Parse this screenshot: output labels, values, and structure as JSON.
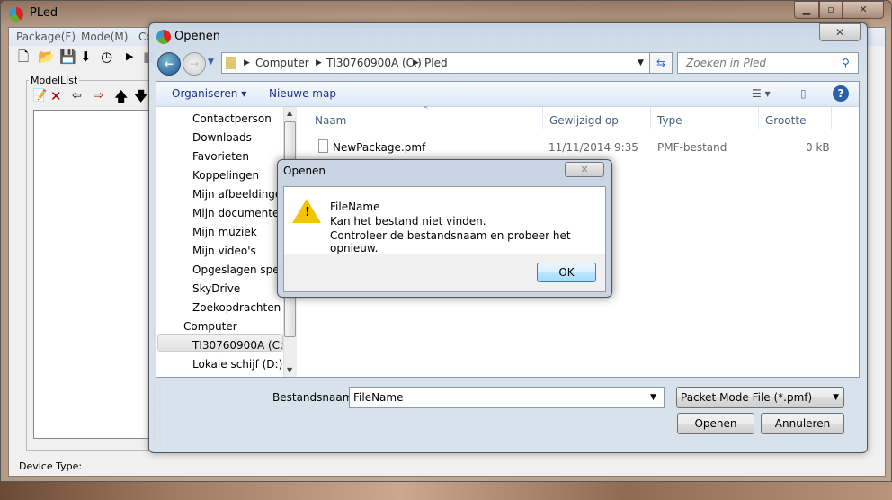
{
  "main_window": {
    "title": "PLed",
    "menu": [
      "Package(F)",
      "Mode(M)",
      "Co"
    ],
    "group_label": "ModelList",
    "status_label": "Device Type:"
  },
  "open_dialog": {
    "title": "Openen",
    "address": [
      "Computer",
      "TI30760900A (C:)",
      "Pled"
    ],
    "search_placeholder": "Zoeken in Pled",
    "toolbar": {
      "organize": "Organiseren",
      "new_folder": "Nieuwe map"
    },
    "nav_items": [
      "Contactperson",
      "Downloads",
      "Favorieten",
      "Koppelingen",
      "Mijn afbeeldingen",
      "Mijn documenten",
      "Mijn muziek",
      "Mijn video's",
      "Opgeslagen spellen",
      "SkyDrive",
      "Zoekopdrachten",
      "Computer",
      "TI30760900A (C:)",
      "Lokale schijf (D:)"
    ],
    "columns": [
      "Naam",
      "Gewijzigd op",
      "Type",
      "Grootte"
    ],
    "files": [
      {
        "name": "NewPackage.pmf",
        "modified": "11/11/2014 9:35",
        "type": "PMF-bestand",
        "size": "0 kB"
      }
    ],
    "filename_label": "Bestandsnaam:",
    "filename_value": "FileName",
    "filter": "Packet Mode File (*.pmf)",
    "open_button": "Openen",
    "cancel_button": "Annuleren"
  },
  "error_dialog": {
    "title": "Openen",
    "lines": [
      "FileName",
      "Kan het bestand niet vinden.",
      "Controleer de bestandsnaam en probeer het opnieuw."
    ],
    "ok": "OK"
  }
}
